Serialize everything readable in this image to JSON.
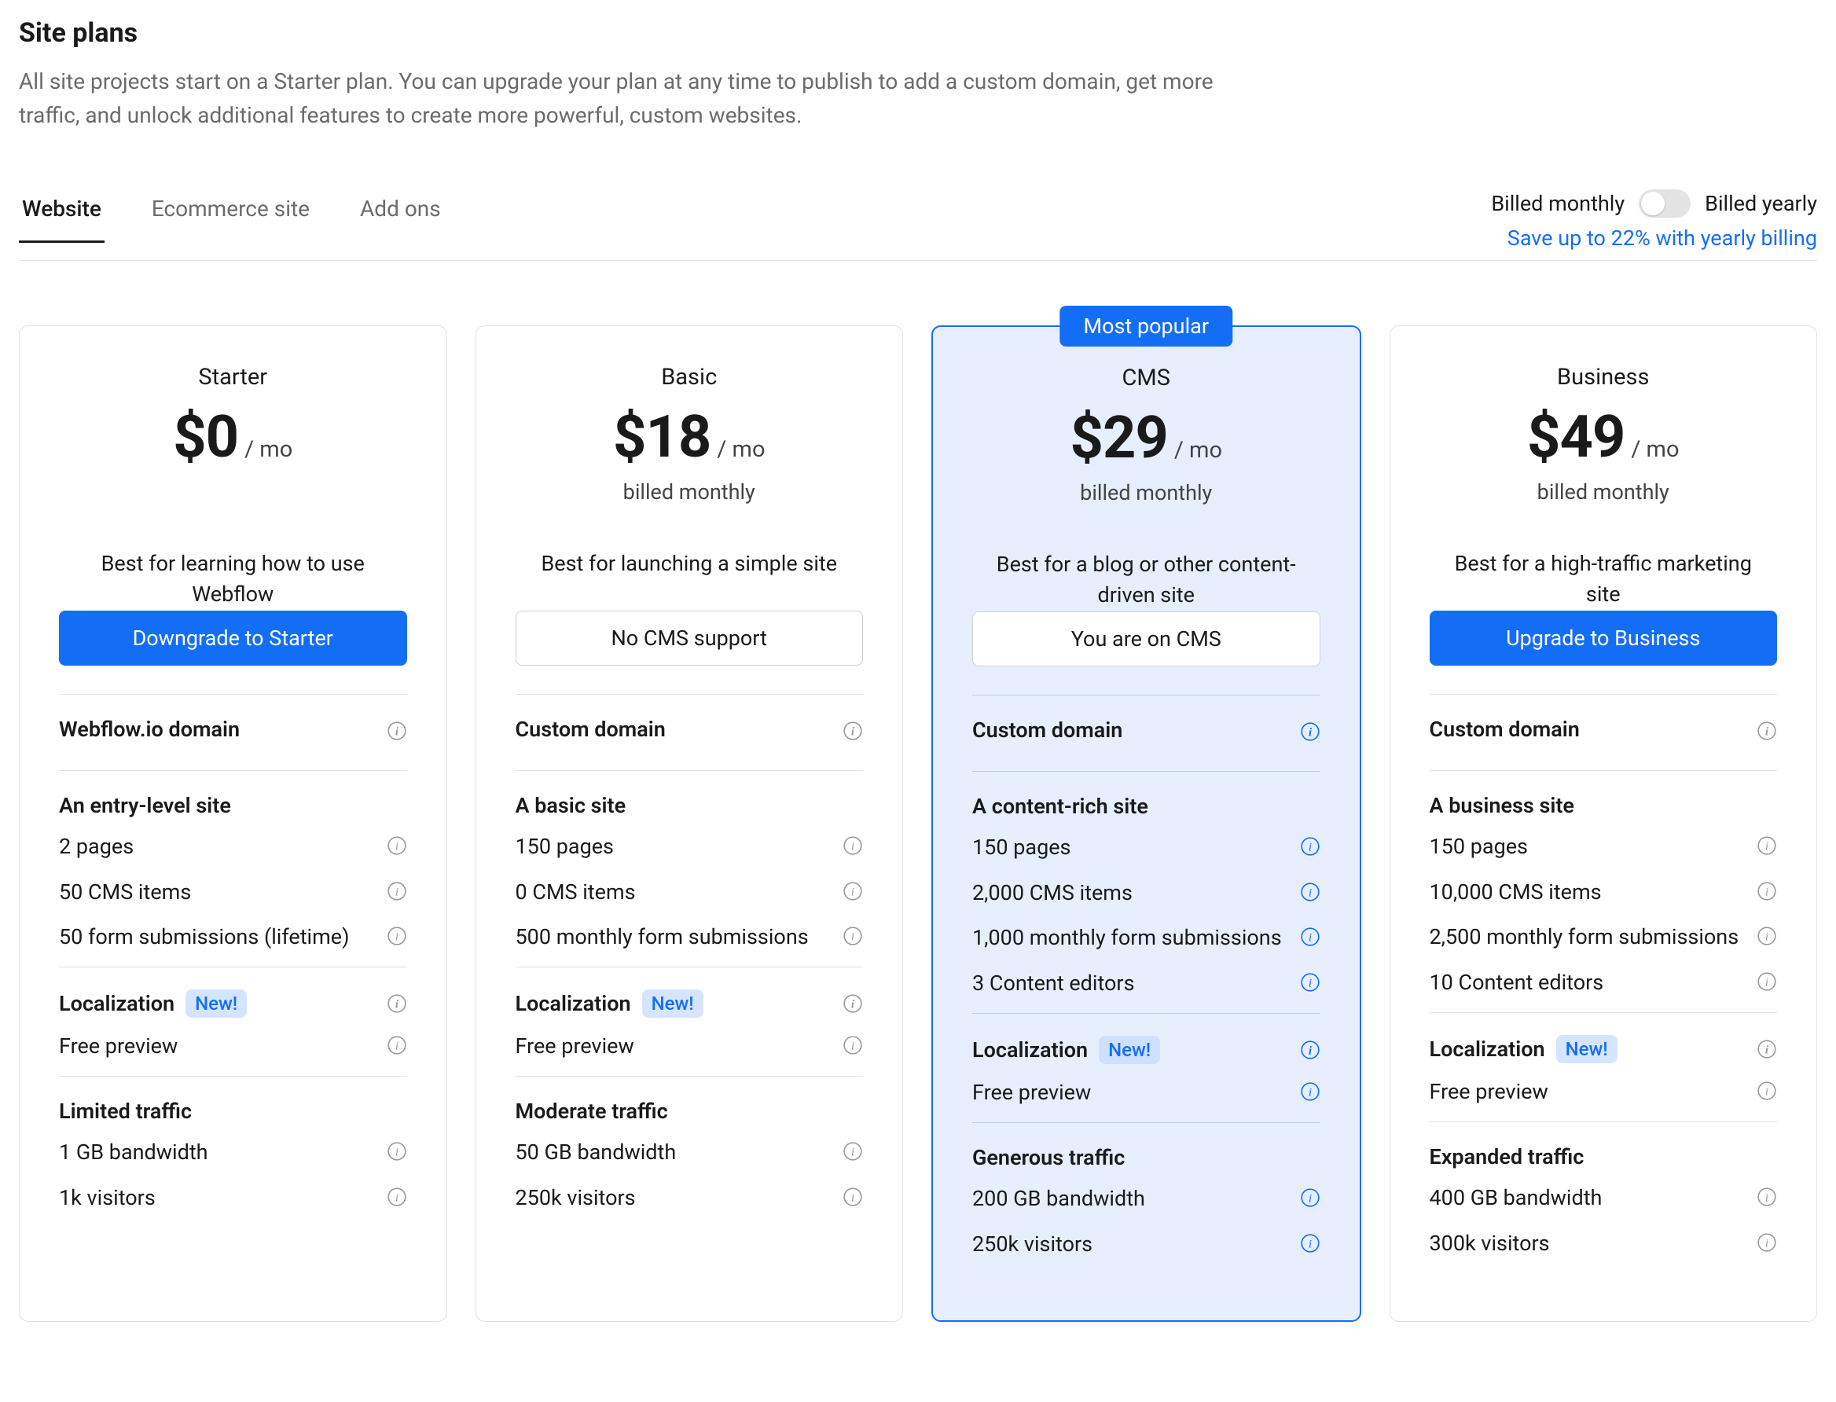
{
  "header": {
    "title": "Site plans",
    "description": "All site projects start on a Starter plan. You can upgrade your plan at any time to publish to add a custom domain, get more traffic, and unlock additional features to create more powerful, custom websites."
  },
  "tabs": {
    "items": [
      {
        "label": "Website",
        "active": true
      },
      {
        "label": "Ecommerce site",
        "active": false
      },
      {
        "label": "Add ons",
        "active": false
      }
    ]
  },
  "billing": {
    "monthly_label": "Billed monthly",
    "yearly_label": "Billed yearly",
    "save_text": "Save up to 22% with yearly billing",
    "toggle_on_yearly": false
  },
  "badges": {
    "new": "New!",
    "most_popular": "Most popular"
  },
  "plans": [
    {
      "name": "Starter",
      "price": "$0",
      "period": "/ mo",
      "billed": "",
      "tagline": "Best for learning how to use Webflow",
      "cta": {
        "label": "Downgrade to Starter",
        "style": "primary"
      },
      "sections": [
        {
          "heading": "Webflow.io domain",
          "has_info": true,
          "items": []
        },
        {
          "heading": "An entry-level site",
          "items": [
            {
              "label": "2 pages",
              "has_info": true
            },
            {
              "label": "50 CMS items",
              "has_info": true
            },
            {
              "label": "50 form submissions (lifetime)",
              "has_info": true
            }
          ]
        },
        {
          "heading": "Localization",
          "new_badge": true,
          "has_info": true,
          "items": [
            {
              "label": "Free preview",
              "has_info": true
            }
          ]
        },
        {
          "heading": "Limited traffic",
          "items": [
            {
              "label": "1 GB bandwidth",
              "has_info": true
            },
            {
              "label": "1k visitors",
              "has_info": true
            }
          ]
        }
      ]
    },
    {
      "name": "Basic",
      "price": "$18",
      "period": "/ mo",
      "billed": "billed monthly",
      "tagline": "Best for launching a simple site",
      "cta": {
        "label": "No CMS support",
        "style": "outline"
      },
      "sections": [
        {
          "heading": "Custom domain",
          "has_info": true,
          "items": []
        },
        {
          "heading": "A basic site",
          "items": [
            {
              "label": "150 pages",
              "has_info": true
            },
            {
              "label": "0 CMS items",
              "has_info": true
            },
            {
              "label": "500 monthly form submissions",
              "has_info": true
            }
          ]
        },
        {
          "heading": "Localization",
          "new_badge": true,
          "has_info": true,
          "items": [
            {
              "label": "Free preview",
              "has_info": true
            }
          ]
        },
        {
          "heading": "Moderate traffic",
          "items": [
            {
              "label": "50 GB bandwidth",
              "has_info": true
            },
            {
              "label": "250k visitors",
              "has_info": true
            }
          ]
        }
      ]
    },
    {
      "name": "CMS",
      "price": "$29",
      "period": "/ mo",
      "billed": "billed monthly",
      "tagline": "Best for a blog or other content-driven site",
      "highlight": true,
      "most_popular": true,
      "cta": {
        "label": "You are on CMS",
        "style": "outline"
      },
      "sections": [
        {
          "heading": "Custom domain",
          "has_info": true,
          "items": []
        },
        {
          "heading": "A content-rich site",
          "items": [
            {
              "label": "150 pages",
              "has_info": true
            },
            {
              "label": "2,000 CMS items",
              "has_info": true
            },
            {
              "label": "1,000 monthly form submissions",
              "has_info": true
            },
            {
              "label": "3 Content editors",
              "has_info": true
            }
          ]
        },
        {
          "heading": "Localization",
          "new_badge": true,
          "has_info": true,
          "items": [
            {
              "label": "Free preview",
              "has_info": true
            }
          ]
        },
        {
          "heading": "Generous traffic",
          "items": [
            {
              "label": "200 GB bandwidth",
              "has_info": true
            },
            {
              "label": "250k visitors",
              "has_info": true
            }
          ]
        }
      ]
    },
    {
      "name": "Business",
      "price": "$49",
      "period": "/ mo",
      "billed": "billed monthly",
      "tagline": "Best for a high-traffic marketing site",
      "cta": {
        "label": "Upgrade to Business",
        "style": "primary"
      },
      "sections": [
        {
          "heading": "Custom domain",
          "has_info": true,
          "items": []
        },
        {
          "heading": "A business site",
          "items": [
            {
              "label": "150 pages",
              "has_info": true
            },
            {
              "label": "10,000 CMS items",
              "has_info": true
            },
            {
              "label": "2,500 monthly form submissions",
              "has_info": true
            },
            {
              "label": "10 Content editors",
              "has_info": true
            }
          ]
        },
        {
          "heading": "Localization",
          "new_badge": true,
          "has_info": true,
          "items": [
            {
              "label": "Free preview",
              "has_info": true
            }
          ]
        },
        {
          "heading": "Expanded traffic",
          "items": [
            {
              "label": "400 GB bandwidth",
              "has_info": true
            },
            {
              "label": "300k visitors",
              "has_info": true
            }
          ]
        }
      ]
    }
  ]
}
